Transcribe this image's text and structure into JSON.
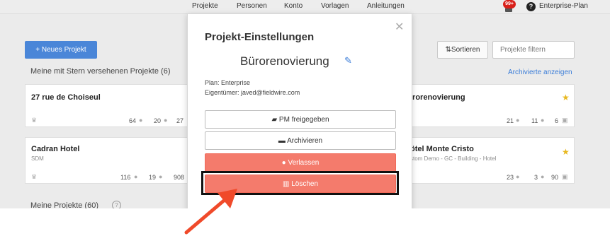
{
  "topnav": {
    "items": [
      "Projekte",
      "Personen",
      "Konto",
      "Vorlagen",
      "Anleitungen"
    ],
    "notification_badge": "99+",
    "help": "?",
    "plan": "Enterprise-Plan"
  },
  "toolbar": {
    "new_project_label": "+ Neues Projekt",
    "sort_label": "Sortieren",
    "filter_placeholder": "Projekte filtern",
    "archived_link": "Archivierte anzeigen"
  },
  "sections": {
    "starred_title": "Meine mit Stern versehenen Projekte (6)",
    "my_projects_title": "Meine Projekte (60)"
  },
  "cards": [
    {
      "title": "27 rue de Choiseul",
      "subtitle": "",
      "stats": [
        "64",
        "20",
        "27"
      ]
    },
    {
      "title": "Cadran Hotel",
      "subtitle": "SDM",
      "stats": [
        "116",
        "19",
        "908"
      ]
    },
    {
      "title": "ırorenovierung",
      "subtitle": "",
      "stats": [
        "21",
        "11",
        "6"
      ]
    },
    {
      "title": "ötel Monte Cristo",
      "subtitle": "stom Demo - GC - Building - Hotel",
      "stats": [
        "23",
        "3",
        "90"
      ]
    }
  ],
  "modal": {
    "title": "Projekt-Einstellungen",
    "project_name": "Bürorenovierung",
    "plan_line": "Plan: Enterprise",
    "owner_line": "Eigentümer: javed@fieldwire.com",
    "buttons": {
      "pm_shared": "PM freigegeben",
      "archive": "Archivieren",
      "leave": "Verlassen",
      "delete": "Löschen"
    }
  },
  "icons": {
    "close": "close-icon",
    "edit": "pencil-icon",
    "briefcase": "briefcase-icon",
    "folder": "folder-icon",
    "user": "user-icon",
    "trash": "trash-icon",
    "star": "star-icon",
    "crown": "crown-icon"
  },
  "colors": {
    "primary": "#4a86d8",
    "danger": "#f47b6c",
    "star": "#e8b820",
    "arrow": "#f04a2a"
  }
}
